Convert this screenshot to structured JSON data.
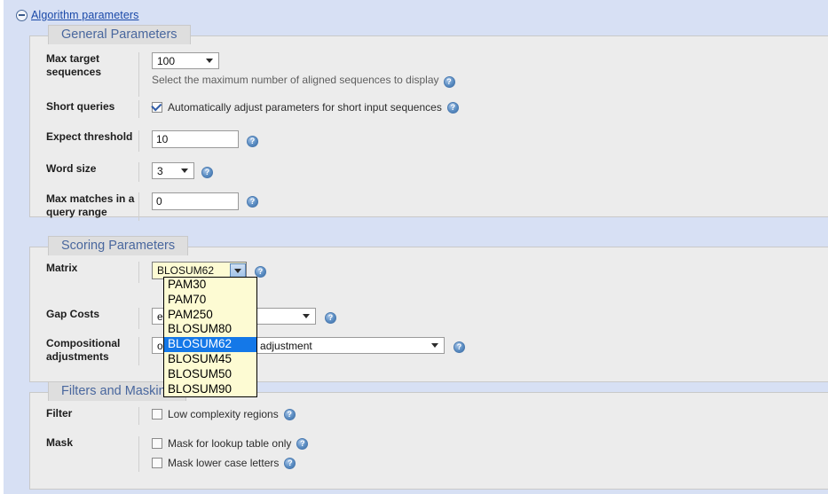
{
  "page": {
    "section_title": "Algorithm parameters",
    "collapse_icon": "minus-circle-icon"
  },
  "general": {
    "legend": "General Parameters",
    "rows": [
      {
        "label": "Max target sequences",
        "control": "select",
        "value": "100",
        "hint": "Select the maximum number of aligned sequences to display",
        "help": "?"
      },
      {
        "label": "Short queries",
        "control": "checkbox",
        "checked": true,
        "text": "Automatically adjust parameters for short input sequences",
        "help": "?"
      },
      {
        "label": "Expect threshold",
        "control": "text",
        "value": "10",
        "help": "?"
      },
      {
        "label": "Word size",
        "control": "select",
        "value": "3",
        "help": "?"
      },
      {
        "label": "Max matches in a query range",
        "control": "text",
        "value": "0",
        "help": "?"
      }
    ]
  },
  "scoring": {
    "legend": "Scoring Parameters",
    "matrix": {
      "label": "Matrix",
      "value": "BLOSUM62",
      "expanded": true,
      "options": [
        "PAM30",
        "PAM70",
        "PAM250",
        "BLOSUM80",
        "BLOSUM62",
        "BLOSUM45",
        "BLOSUM50",
        "BLOSUM90"
      ],
      "selected": "BLOSUM62",
      "help": "?"
    },
    "gap_costs": {
      "label": "Gap Costs",
      "value": "ension: 1",
      "help": "?"
    },
    "compositional": {
      "label": "Compositional adjustments",
      "value": "ositional score matrix adjustment",
      "help": "?"
    }
  },
  "filters": {
    "legend": "Filters and Masking",
    "filter": {
      "label": "Filter",
      "items": [
        {
          "text": "Low complexity regions",
          "checked": false,
          "help": "?"
        }
      ]
    },
    "mask": {
      "label": "Mask",
      "items": [
        {
          "text": "Mask for lookup table only",
          "checked": false,
          "help": "?"
        },
        {
          "text": "Mask lower case letters",
          "checked": false,
          "help": "?"
        }
      ]
    }
  },
  "colors": {
    "page_blue": "#d7e0f4",
    "fieldset_bg": "#ececec",
    "legend_bg": "#dedede",
    "legend_text": "#49679e",
    "link": "#1a49a8",
    "dropdown_bg": "#fdfbd3",
    "highlight": "#1478e8"
  }
}
